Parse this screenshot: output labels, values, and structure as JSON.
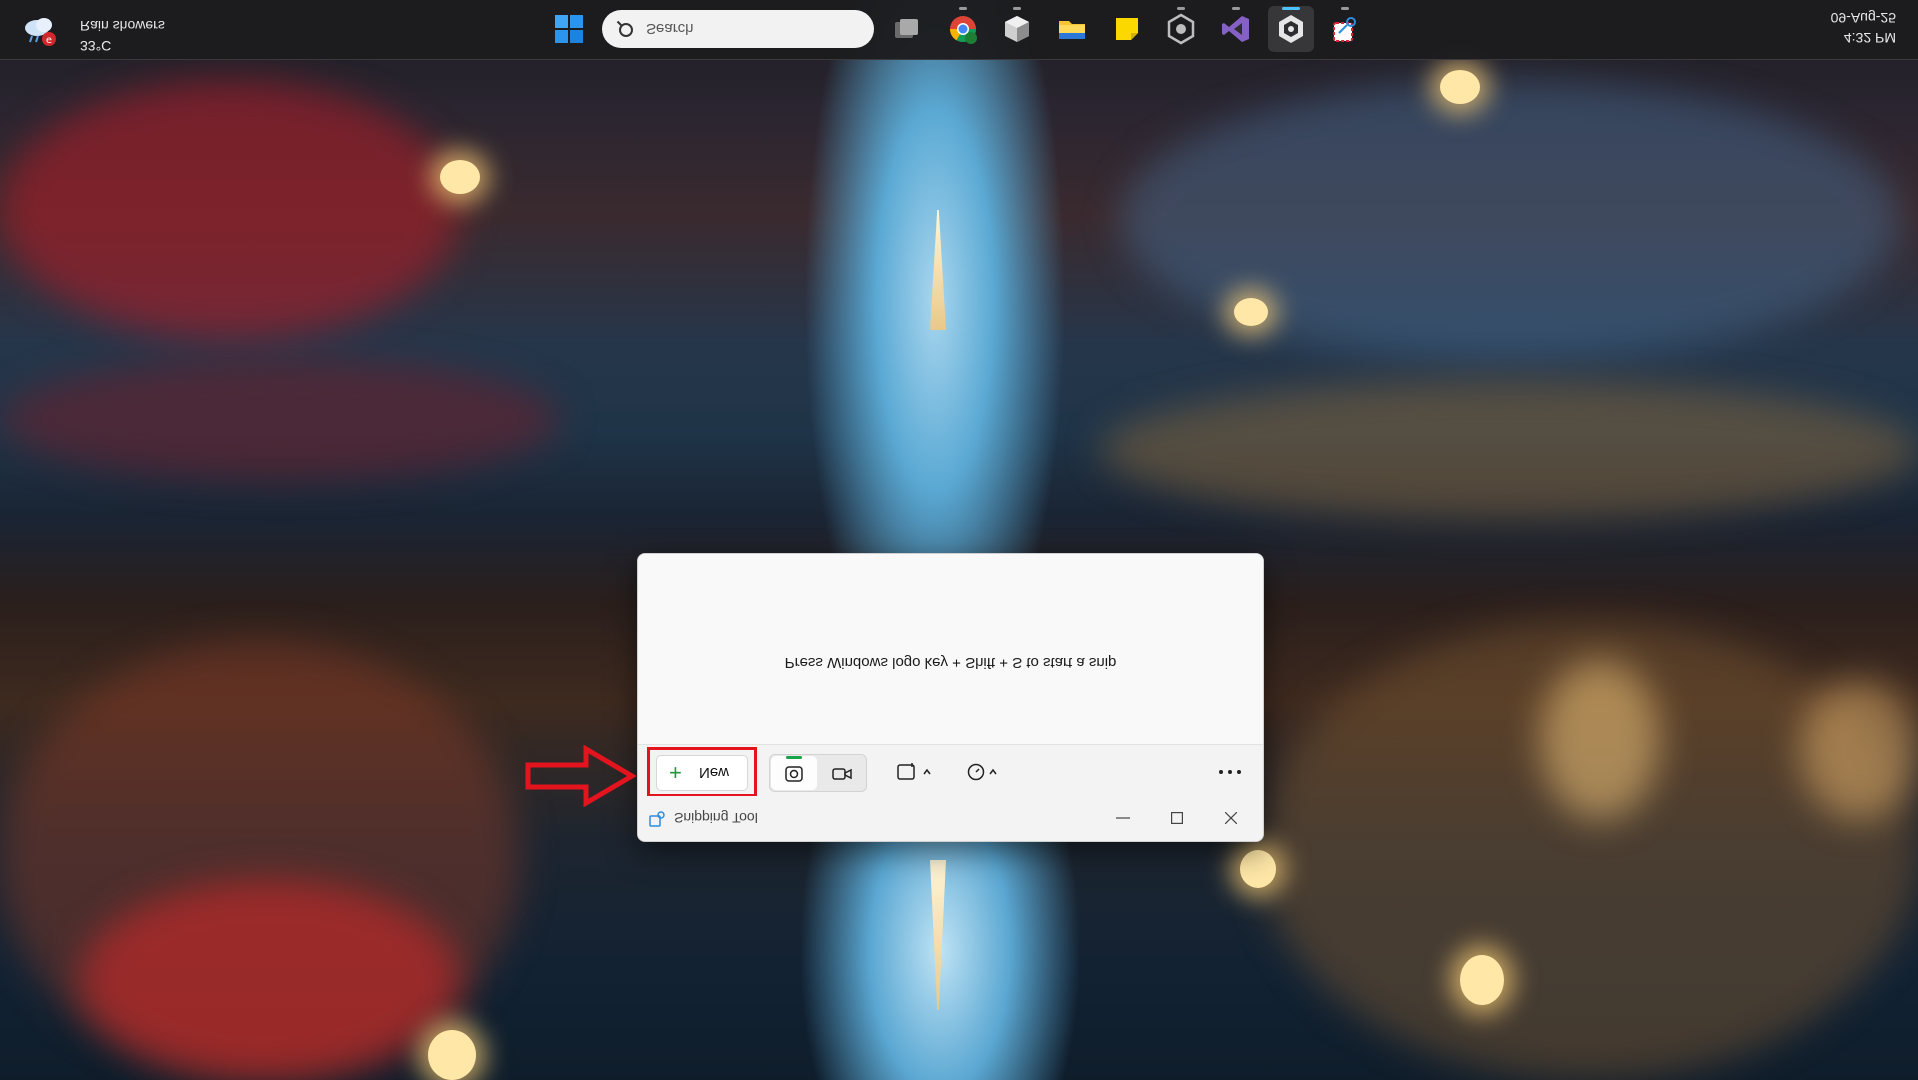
{
  "taskbar": {
    "weather": {
      "condition": "Rain showers",
      "temperature": "33°C"
    },
    "search": {
      "placeholder": "Search"
    },
    "apps": [
      "task-view",
      "chrome",
      "app-3d",
      "file-explorer",
      "sticky-notes",
      "app-hex",
      "visual-studio",
      "app-active",
      "snipping-tool"
    ],
    "clock": {
      "date": "09-Aug-25",
      "time": "4:32 PM"
    }
  },
  "snipping_tool": {
    "title": "Snipping Tool",
    "hint": "Press Windows logo key + Shift + S to start a snip",
    "new_label": "New",
    "more_label": "···"
  },
  "colors": {
    "accent": "#1aa34a",
    "highlight": "#e3141e",
    "taskbar_active": "#4cc2ff"
  }
}
